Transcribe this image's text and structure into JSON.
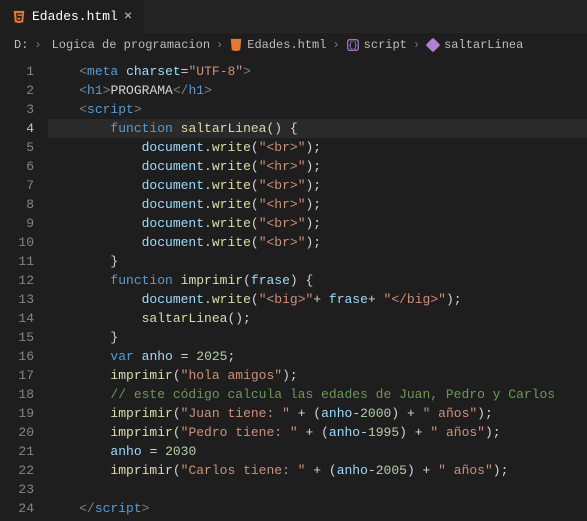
{
  "tab": {
    "filename": "Edades.html",
    "close_glyph": "×"
  },
  "breadcrumbs": {
    "root": "D:",
    "folder": "Logica de programacion",
    "file": "Edades.html",
    "script": "script",
    "fn": "saltarLinea"
  },
  "chev": "›",
  "lines": {
    "count": 24,
    "current": 4
  },
  "code": {
    "l1": {
      "charset_attr": "charset",
      "charset_val": "\"UTF-8\"",
      "tag": "meta"
    },
    "l2": {
      "open": "h1",
      "text": "PROGRAMA",
      "close": "h1"
    },
    "l3": {
      "tag": "script"
    },
    "l4": {
      "kw": "function",
      "name": "saltarLinea"
    },
    "l5": {
      "obj": "document",
      "fn": "write",
      "arg": "\"<br>\""
    },
    "l6": {
      "obj": "document",
      "fn": "write",
      "arg": "\"<hr>\""
    },
    "l7": {
      "obj": "document",
      "fn": "write",
      "arg": "\"<br>\""
    },
    "l8": {
      "obj": "document",
      "fn": "write",
      "arg": "\"<hr>\""
    },
    "l9": {
      "obj": "document",
      "fn": "write",
      "arg": "\"<br>\""
    },
    "l10": {
      "obj": "document",
      "fn": "write",
      "arg": "\"<br>\""
    },
    "l12": {
      "kw": "function",
      "name": "imprimir",
      "param": "frase"
    },
    "l13": {
      "obj": "document",
      "fn": "write",
      "s1": "\"<big>\"",
      "v": "frase",
      "s2": "\"</big>\""
    },
    "l14": {
      "call": "saltarLinea"
    },
    "l16": {
      "kw": "var",
      "name": "anho",
      "val": "2025"
    },
    "l17": {
      "call": "imprimir",
      "arg": "\"hola amigos\""
    },
    "l18": {
      "comment": "// este código calcula las edades de Juan, Pedro y Carlos"
    },
    "l19": {
      "call": "imprimir",
      "s1": "\"Juan tiene: \"",
      "v": "anho",
      "n": "2000",
      "s2": "\" años\""
    },
    "l20": {
      "call": "imprimir",
      "s1": "\"Pedro tiene: \"",
      "v": "anho",
      "n": "1995",
      "s2": "\" años\""
    },
    "l21": {
      "name": "anho",
      "val": "2030"
    },
    "l22": {
      "call": "imprimir",
      "s1": "\"Carlos tiene: \"",
      "v": "anho",
      "n": "2005",
      "s2": "\" años\""
    },
    "l24": {
      "tag": "script"
    }
  }
}
